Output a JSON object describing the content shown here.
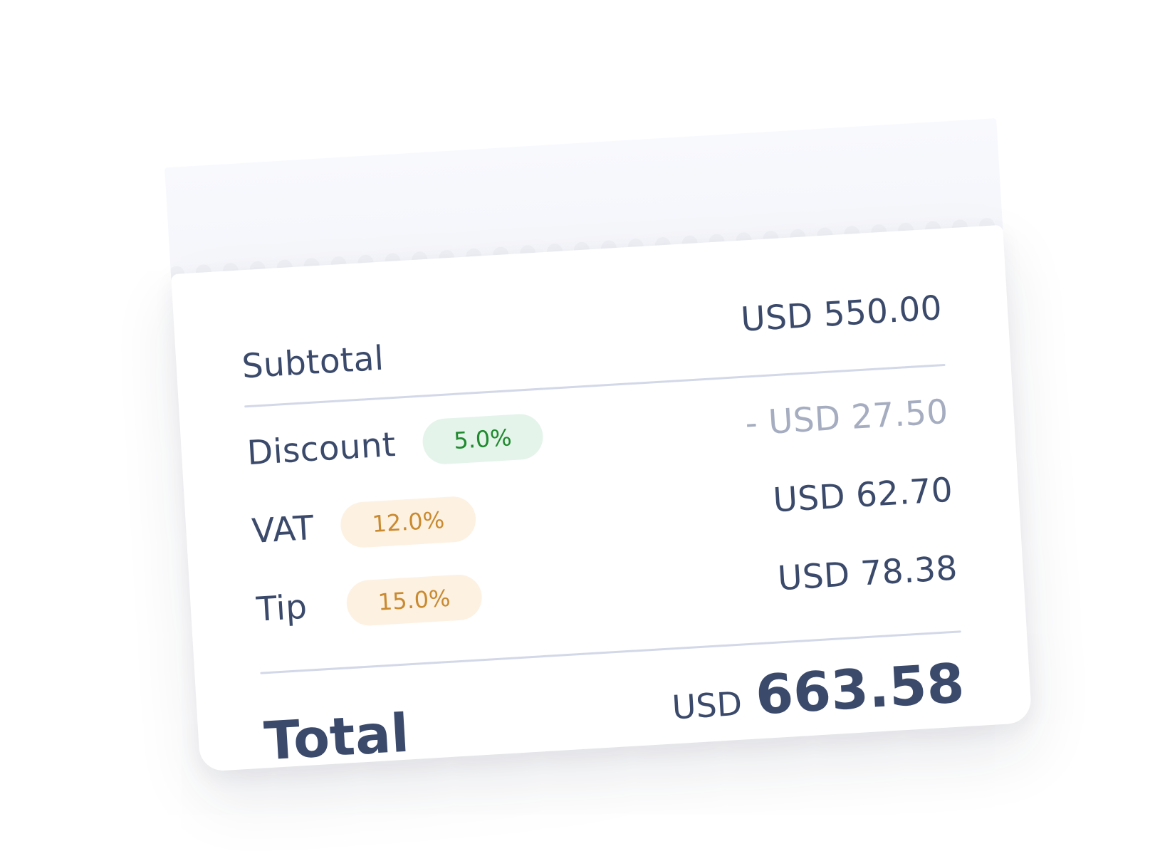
{
  "receipt": {
    "subtotal": {
      "label": "Subtotal",
      "amount": "USD 550.00"
    },
    "discount": {
      "label": "Discount",
      "badge": "5.0%",
      "amount": "- USD 27.50"
    },
    "vat": {
      "label": "VAT",
      "badge": "12.0%",
      "amount": "USD 62.70"
    },
    "tip": {
      "label": "Tip",
      "badge": "15.0%",
      "amount": "USD 78.38"
    },
    "total": {
      "label": "Total",
      "currency": "USD",
      "amount": "663.58"
    }
  },
  "colors": {
    "text": "#3b4a6b",
    "muted": "#a6adc0",
    "discount_badge_bg": "#e4f4ea",
    "discount_badge_text": "#1f8a2e",
    "percent_badge_bg": "#fdf1e2",
    "percent_badge_text": "#c98a30",
    "divider": "#d3d8e8"
  }
}
